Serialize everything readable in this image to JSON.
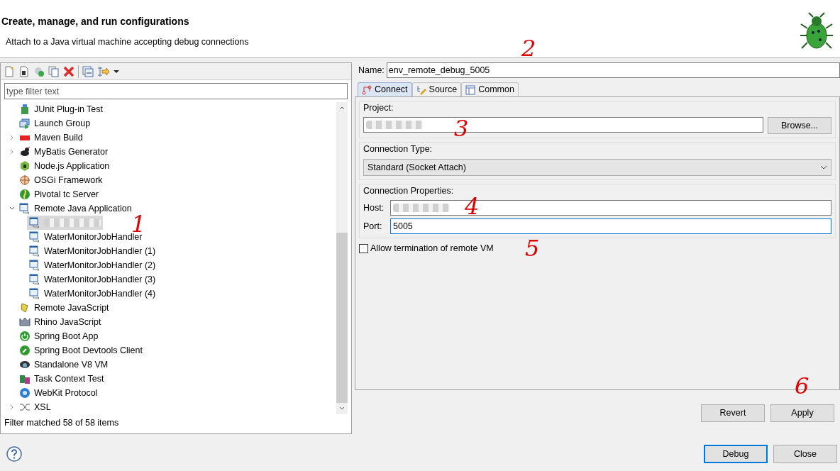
{
  "header": {
    "title": "Create, manage, and run configurations",
    "subtitle": "Attach to a Java virtual machine accepting debug connections"
  },
  "filter": {
    "placeholder": "type filter text"
  },
  "tree": [
    {
      "label": "JUnit Plug-in Test"
    },
    {
      "label": "Launch Group"
    },
    {
      "label": "Maven Build",
      "expanded": false
    },
    {
      "label": "MyBatis Generator",
      "expanded": false
    },
    {
      "label": "Node.js Application"
    },
    {
      "label": "OSGi Framework"
    },
    {
      "label": "Pivotal tc Server"
    },
    {
      "label": "Remote Java Application",
      "expanded": true,
      "children": [
        {
          "redacted": true,
          "selected": true
        },
        {
          "label": "WaterMonitorJobHandler",
          "selected": false
        },
        {
          "label": "WaterMonitorJobHandler (1)",
          "selected": false
        },
        {
          "label": "WaterMonitorJobHandler (2)",
          "selected": false
        },
        {
          "label": "WaterMonitorJobHandler (3)",
          "selected": false
        },
        {
          "label": "WaterMonitorJobHandler (4)",
          "selected": false
        }
      ]
    },
    {
      "label": "Remote JavaScript"
    },
    {
      "label": "Rhino JavaScript"
    },
    {
      "label": "Spring Boot App"
    },
    {
      "label": "Spring Boot Devtools Client"
    },
    {
      "label": "Standalone V8 VM"
    },
    {
      "label": "Task Context Test"
    },
    {
      "label": "WebKit Protocol"
    },
    {
      "label": "XSL",
      "expanded": false
    }
  ],
  "filter_status": "Filter matched 58 of 58 items",
  "name": {
    "label": "Name:",
    "value": "env_remote_debug_5005"
  },
  "tabs": [
    {
      "label": "Connect",
      "selected": true
    },
    {
      "label": "Source",
      "selected": false
    },
    {
      "label": "Common",
      "selected": false
    }
  ],
  "project": {
    "label": "Project:",
    "redacted": true,
    "browse": "Browse..."
  },
  "connection_type": {
    "label": "Connection Type:",
    "value": "Standard (Socket Attach)"
  },
  "connection_properties": {
    "label": "Connection Properties:",
    "host_label": "Host:",
    "host_redacted": true,
    "port_label": "Port:",
    "port_value": "5005",
    "port_focused": true
  },
  "allow_termination": {
    "label": "Allow termination of remote VM",
    "checked": false
  },
  "panel_buttons": [
    "Revert",
    "Apply"
  ],
  "dialog_buttons": [
    {
      "label": "Debug",
      "default": true
    },
    {
      "label": "Close",
      "default": false
    }
  ],
  "annotations": [
    {
      "text": "1"
    },
    {
      "text": "2"
    },
    {
      "text": "3"
    },
    {
      "text": "4"
    },
    {
      "text": "5"
    },
    {
      "text": "6"
    }
  ]
}
